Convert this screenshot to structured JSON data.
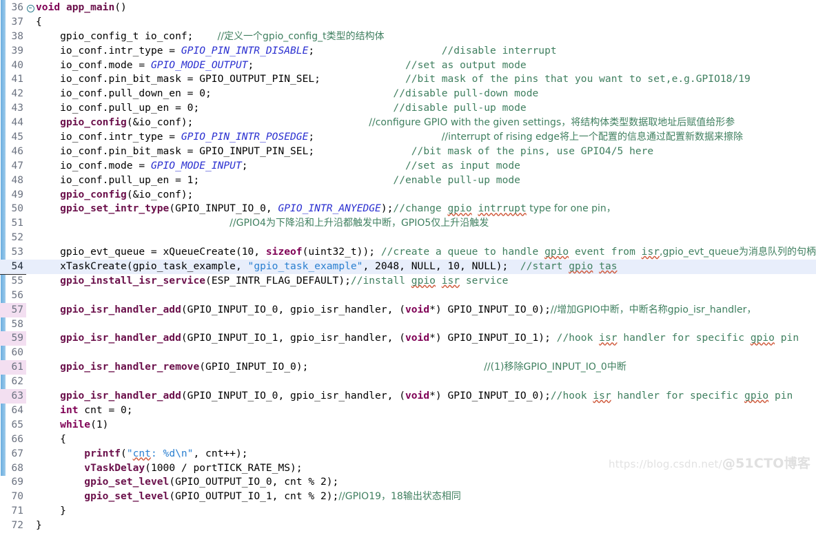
{
  "editor": {
    "title": "code-editor",
    "language": "C",
    "current_line": 54,
    "first_line": 36,
    "last_line": 72,
    "colors": {
      "background": "#ffffff",
      "keyword": "#7f0055",
      "function": "#6a0f4a",
      "enum_constant": "#2a2fd0",
      "string": "#2a7fd0",
      "comment": "#3f7f5f",
      "gutter_text": "#6b7280",
      "current_line_bg": "#e8eefb",
      "changed_gutter_bg": "#f3dff1",
      "change_bar": "#6aaee0"
    }
  },
  "watermark": {
    "url": "https://blog.csdn.net/",
    "handle": "@51CTO博客"
  },
  "lines": [
    {
      "n": 36,
      "fold": true,
      "changed": false,
      "current": false,
      "tokens": [
        {
          "t": "void",
          "c": "kw"
        },
        {
          "t": " ",
          "c": "plain"
        },
        {
          "t": "app_main",
          "c": "fn"
        },
        {
          "t": "()",
          "c": "plain"
        }
      ]
    },
    {
      "n": 37,
      "fold": false,
      "changed": false,
      "current": false,
      "tokens": [
        {
          "t": "{",
          "c": "plain"
        }
      ]
    },
    {
      "n": 38,
      "fold": false,
      "changed": false,
      "current": false,
      "tokens": [
        {
          "t": "    gpio_config_t io_conf;",
          "c": "fn-lead"
        },
        {
          "t": "    ",
          "c": "plain"
        },
        {
          "t": "//定义一个gpio_config_t类型的结构体",
          "c": "cmt cn"
        }
      ]
    },
    {
      "n": 39,
      "fold": false,
      "changed": false,
      "current": false,
      "tokens": [
        {
          "t": "    io_conf.",
          "c": "plain"
        },
        {
          "t": "intr_type",
          "c": "field"
        },
        {
          "t": " = ",
          "c": "plain"
        },
        {
          "t": "GPIO_PIN_INTR_DISABLE",
          "c": "enum"
        },
        {
          "t": ";",
          "c": "plain"
        },
        {
          "t": "                     ",
          "c": "plain"
        },
        {
          "t": "//disable interrupt",
          "c": "cmt"
        }
      ]
    },
    {
      "n": 40,
      "fold": false,
      "changed": false,
      "current": false,
      "tokens": [
        {
          "t": "    io_conf.",
          "c": "plain"
        },
        {
          "t": "mode",
          "c": "field"
        },
        {
          "t": " = ",
          "c": "plain"
        },
        {
          "t": "GPIO_MODE_OUTPUT",
          "c": "enum"
        },
        {
          "t": ";",
          "c": "plain"
        },
        {
          "t": "                         ",
          "c": "plain"
        },
        {
          "t": "//set as output mode",
          "c": "cmt"
        }
      ]
    },
    {
      "n": 41,
      "fold": false,
      "changed": false,
      "current": false,
      "tokens": [
        {
          "t": "    io_conf.",
          "c": "plain"
        },
        {
          "t": "pin_bit_mask",
          "c": "field"
        },
        {
          "t": " = GPIO_OUTPUT_PIN_SEL;",
          "c": "plain"
        },
        {
          "t": "              ",
          "c": "plain"
        },
        {
          "t": "//bit mask of the pins that you want to set,e.g.GPIO18/19",
          "c": "cmt"
        }
      ]
    },
    {
      "n": 42,
      "fold": false,
      "changed": false,
      "current": false,
      "tokens": [
        {
          "t": "    io_conf.",
          "c": "plain"
        },
        {
          "t": "pull_down_en",
          "c": "field"
        },
        {
          "t": " = 0;",
          "c": "plain"
        },
        {
          "t": "                              ",
          "c": "plain"
        },
        {
          "t": "//disable pull-down mode",
          "c": "cmt"
        }
      ]
    },
    {
      "n": 43,
      "fold": false,
      "changed": false,
      "current": false,
      "tokens": [
        {
          "t": "    io_conf.",
          "c": "plain"
        },
        {
          "t": "pull_up_en",
          "c": "field"
        },
        {
          "t": " = 0;",
          "c": "plain"
        },
        {
          "t": "                                ",
          "c": "plain"
        },
        {
          "t": "//disable pull-up mode",
          "c": "cmt"
        }
      ]
    },
    {
      "n": 44,
      "fold": false,
      "changed": false,
      "current": false,
      "tokens": [
        {
          "t": "    ",
          "c": "plain"
        },
        {
          "t": "gpio_config",
          "c": "fn"
        },
        {
          "t": "(&io_conf);",
          "c": "plain"
        },
        {
          "t": "                             ",
          "c": "plain"
        },
        {
          "t": "//configure GPIO with the given settings，将结构体类型数据取地址后赋值给形参",
          "c": "cmt cn"
        }
      ]
    },
    {
      "n": 45,
      "fold": false,
      "changed": false,
      "current": false,
      "tokens": [
        {
          "t": "    io_conf.",
          "c": "plain"
        },
        {
          "t": "intr_type",
          "c": "field"
        },
        {
          "t": " = ",
          "c": "plain"
        },
        {
          "t": "GPIO_PIN_INTR_POSEDGE",
          "c": "enum"
        },
        {
          "t": ";",
          "c": "plain"
        },
        {
          "t": "                     ",
          "c": "plain"
        },
        {
          "t": "//interrupt of rising edge将上一个配置的信息通过配置新数据来擦除",
          "c": "cmt cn"
        }
      ]
    },
    {
      "n": 46,
      "fold": false,
      "changed": false,
      "current": false,
      "tokens": [
        {
          "t": "    io_conf.",
          "c": "plain"
        },
        {
          "t": "pin_bit_mask",
          "c": "field"
        },
        {
          "t": " = GPIO_INPUT_PIN_SEL;",
          "c": "plain"
        },
        {
          "t": "                ",
          "c": "plain"
        },
        {
          "t": "//bit mask of the pins, use GPIO4/5 here",
          "c": "cmt"
        }
      ]
    },
    {
      "n": 47,
      "fold": false,
      "changed": false,
      "current": false,
      "tokens": [
        {
          "t": "    io_conf.",
          "c": "plain"
        },
        {
          "t": "mode",
          "c": "field"
        },
        {
          "t": " = ",
          "c": "plain"
        },
        {
          "t": "GPIO_MODE_INPUT",
          "c": "enum"
        },
        {
          "t": ";",
          "c": "plain"
        },
        {
          "t": "                          ",
          "c": "plain"
        },
        {
          "t": "//set as input mode",
          "c": "cmt"
        }
      ]
    },
    {
      "n": 48,
      "fold": false,
      "changed": false,
      "current": false,
      "tokens": [
        {
          "t": "    io_conf.",
          "c": "plain"
        },
        {
          "t": "pull_up_en",
          "c": "field"
        },
        {
          "t": " = 1;",
          "c": "plain"
        },
        {
          "t": "                                ",
          "c": "plain"
        },
        {
          "t": "//enable pull-up mode",
          "c": "cmt"
        }
      ]
    },
    {
      "n": 49,
      "fold": false,
      "changed": false,
      "current": false,
      "tokens": [
        {
          "t": "    ",
          "c": "plain"
        },
        {
          "t": "gpio_config",
          "c": "fn"
        },
        {
          "t": "(&io_conf);",
          "c": "plain"
        }
      ]
    },
    {
      "n": 50,
      "fold": false,
      "changed": false,
      "current": false,
      "tokens": [
        {
          "t": "    ",
          "c": "plain"
        },
        {
          "t": "gpio_set_intr_type",
          "c": "fn"
        },
        {
          "t": "(GPIO_INPUT_IO_0, ",
          "c": "plain"
        },
        {
          "t": "GPIO_INTR_ANYEDGE",
          "c": "enum"
        },
        {
          "t": ");",
          "c": "plain"
        },
        {
          "t": "//change ",
          "c": "cmt"
        },
        {
          "t": "gpio",
          "c": "cmt sq"
        },
        {
          "t": " ",
          "c": "cmt"
        },
        {
          "t": "intrrupt",
          "c": "cmt sq"
        },
        {
          "t": " type for one pin，",
          "c": "cmt cn"
        }
      ]
    },
    {
      "n": 51,
      "fold": false,
      "changed": false,
      "current": false,
      "tokens": [
        {
          "t": "                                ",
          "c": "plain"
        },
        {
          "t": "//GPIO4为下降沿和上升沿都触发中断，GPIO5仅上升沿触发",
          "c": "cmt cn"
        }
      ]
    },
    {
      "n": 52,
      "fold": false,
      "changed": false,
      "current": false,
      "tokens": []
    },
    {
      "n": 53,
      "fold": false,
      "changed": false,
      "current": false,
      "tokens": [
        {
          "t": "    gpio_evt_queue = xQueueCreate(10, ",
          "c": "plain"
        },
        {
          "t": "sizeof",
          "c": "kw"
        },
        {
          "t": "(uint32_t)); ",
          "c": "plain"
        },
        {
          "t": "//create a queue to handle ",
          "c": "cmt"
        },
        {
          "t": "gpio",
          "c": "cmt sq"
        },
        {
          "t": " event from ",
          "c": "cmt"
        },
        {
          "t": "isr",
          "c": "cmt sq"
        },
        {
          "t": ",gpio_evt_queue为消息队列的句柄",
          "c": "cmt cn"
        }
      ]
    },
    {
      "n": 54,
      "fold": false,
      "changed": false,
      "current": true,
      "tokens": [
        {
          "t": "    xTaskCreate(gpio_task_example, ",
          "c": "plain"
        },
        {
          "t": "\"gpio_task_example\"",
          "c": "str"
        },
        {
          "t": ", 2048, NULL, 10, NULL);  ",
          "c": "plain"
        },
        {
          "t": "//start ",
          "c": "cmt"
        },
        {
          "t": "gpio",
          "c": "cmt sq"
        },
        {
          "t": " ",
          "c": "cmt"
        },
        {
          "t": "tas",
          "c": "cmt sq"
        }
      ]
    },
    {
      "n": 55,
      "fold": false,
      "changed": false,
      "current": false,
      "tokens": [
        {
          "t": "    ",
          "c": "plain"
        },
        {
          "t": "gpio_install_isr_service",
          "c": "fn"
        },
        {
          "t": "(ESP_INTR_FLAG_DEFAULT);",
          "c": "plain"
        },
        {
          "t": "//install ",
          "c": "cmt"
        },
        {
          "t": "gpio",
          "c": "cmt sq"
        },
        {
          "t": " ",
          "c": "cmt"
        },
        {
          "t": "isr",
          "c": "cmt sq"
        },
        {
          "t": " service",
          "c": "cmt"
        }
      ]
    },
    {
      "n": 56,
      "fold": false,
      "changed": false,
      "current": false,
      "tokens": []
    },
    {
      "n": 57,
      "fold": false,
      "changed": true,
      "current": false,
      "tokens": [
        {
          "t": "    ",
          "c": "plain"
        },
        {
          "t": "gpio_isr_handler_add",
          "c": "fn"
        },
        {
          "t": "(GPIO_INPUT_IO_0, gpio_isr_handler, (",
          "c": "plain"
        },
        {
          "t": "void",
          "c": "kw"
        },
        {
          "t": "*) GPIO_INPUT_IO_0);",
          "c": "plain"
        },
        {
          "t": "//增加GPIO中断，中断名称gpio_isr_handler，",
          "c": "cmt cn"
        }
      ]
    },
    {
      "n": 58,
      "fold": false,
      "changed": false,
      "current": false,
      "tokens": []
    },
    {
      "n": 59,
      "fold": false,
      "changed": true,
      "current": false,
      "tokens": [
        {
          "t": "    ",
          "c": "plain"
        },
        {
          "t": "gpio_isr_handler_add",
          "c": "fn"
        },
        {
          "t": "(GPIO_INPUT_IO_1, gpio_isr_handler, (",
          "c": "plain"
        },
        {
          "t": "void",
          "c": "kw"
        },
        {
          "t": "*) GPIO_INPUT_IO_1); ",
          "c": "plain"
        },
        {
          "t": "//hook ",
          "c": "cmt"
        },
        {
          "t": "isr",
          "c": "cmt sq"
        },
        {
          "t": " handler for specific ",
          "c": "cmt"
        },
        {
          "t": "gpio",
          "c": "cmt sq"
        },
        {
          "t": " pin",
          "c": "cmt"
        }
      ]
    },
    {
      "n": 60,
      "fold": false,
      "changed": false,
      "current": false,
      "tokens": []
    },
    {
      "n": 61,
      "fold": false,
      "changed": true,
      "current": false,
      "tokens": [
        {
          "t": "    ",
          "c": "plain"
        },
        {
          "t": "gpio_isr_handler_remove",
          "c": "fn"
        },
        {
          "t": "(GPIO_INPUT_IO_0);",
          "c": "plain"
        },
        {
          "t": "                             ",
          "c": "plain"
        },
        {
          "t": "//(1)移除GPIO_INPUT_IO_0中断",
          "c": "cmt cn"
        }
      ]
    },
    {
      "n": 62,
      "fold": false,
      "changed": false,
      "current": false,
      "tokens": []
    },
    {
      "n": 63,
      "fold": false,
      "changed": true,
      "current": false,
      "tokens": [
        {
          "t": "    ",
          "c": "plain"
        },
        {
          "t": "gpio_isr_handler_add",
          "c": "fn"
        },
        {
          "t": "(GPIO_INPUT_IO_0, gpio_isr_handler, (",
          "c": "plain"
        },
        {
          "t": "void",
          "c": "kw"
        },
        {
          "t": "*) GPIO_INPUT_IO_0);",
          "c": "plain"
        },
        {
          "t": "//hook ",
          "c": "cmt"
        },
        {
          "t": "isr",
          "c": "cmt sq"
        },
        {
          "t": " handler for specific ",
          "c": "cmt"
        },
        {
          "t": "gpio",
          "c": "cmt sq"
        },
        {
          "t": " pin",
          "c": "cmt"
        }
      ]
    },
    {
      "n": 64,
      "fold": false,
      "changed": false,
      "current": false,
      "tokens": [
        {
          "t": "    ",
          "c": "plain"
        },
        {
          "t": "int",
          "c": "kw"
        },
        {
          "t": " cnt = 0;",
          "c": "plain"
        }
      ]
    },
    {
      "n": 65,
      "fold": false,
      "changed": false,
      "current": false,
      "tokens": [
        {
          "t": "    ",
          "c": "plain"
        },
        {
          "t": "while",
          "c": "kw"
        },
        {
          "t": "(1)",
          "c": "plain"
        }
      ]
    },
    {
      "n": 66,
      "fold": false,
      "changed": false,
      "current": false,
      "tokens": [
        {
          "t": "    {",
          "c": "plain"
        }
      ]
    },
    {
      "n": 67,
      "fold": false,
      "changed": false,
      "current": false,
      "tokens": [
        {
          "t": "        ",
          "c": "plain"
        },
        {
          "t": "printf",
          "c": "fn"
        },
        {
          "t": "(",
          "c": "plain"
        },
        {
          "t": "\"",
          "c": "str"
        },
        {
          "t": "cnt",
          "c": "str sq"
        },
        {
          "t": ": %d\\n\"",
          "c": "str"
        },
        {
          "t": ", cnt++);",
          "c": "plain"
        }
      ]
    },
    {
      "n": 68,
      "fold": false,
      "changed": false,
      "current": false,
      "tokens": [
        {
          "t": "        ",
          "c": "plain"
        },
        {
          "t": "vTaskDelay",
          "c": "fn"
        },
        {
          "t": "(1000 / portTICK_RATE_MS);",
          "c": "plain"
        }
      ]
    },
    {
      "n": 69,
      "fold": false,
      "changed": false,
      "current": false,
      "tokens": [
        {
          "t": "        ",
          "c": "plain"
        },
        {
          "t": "gpio_set_level",
          "c": "fn"
        },
        {
          "t": "(GPIO_OUTPUT_IO_0, cnt % 2);",
          "c": "plain"
        }
      ]
    },
    {
      "n": 70,
      "fold": false,
      "changed": false,
      "current": false,
      "tokens": [
        {
          "t": "        ",
          "c": "plain"
        },
        {
          "t": "gpio_set_level",
          "c": "fn"
        },
        {
          "t": "(GPIO_OUTPUT_IO_1, cnt % 2);",
          "c": "plain"
        },
        {
          "t": "//GPIO19，18输出状态相同",
          "c": "cmt cn"
        }
      ]
    },
    {
      "n": 71,
      "fold": false,
      "changed": false,
      "current": false,
      "tokens": [
        {
          "t": "    }",
          "c": "plain"
        }
      ]
    },
    {
      "n": 72,
      "fold": false,
      "changed": false,
      "current": false,
      "tokens": [
        {
          "t": "}",
          "c": "plain"
        }
      ]
    }
  ]
}
